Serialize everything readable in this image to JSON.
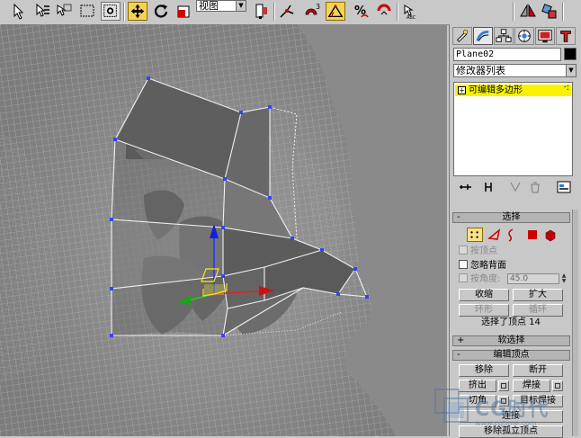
{
  "toolbar": {
    "view_selector": "视图",
    "snap_value": "3",
    "active_tool": "select-and-move"
  },
  "command_panel": {
    "object_name": "Plane02",
    "object_color": "#000000",
    "modifier_list": "修改器列表",
    "modifier_stack": [
      {
        "label": "可编辑多边形",
        "expand_glyph": "+",
        "highlight": "#f8f200"
      }
    ],
    "rollouts": {
      "selection": {
        "header": "选择",
        "sign": "-",
        "by_vertex": "按顶点",
        "ignore_backfacing": "忽略背面",
        "by_angle": "按角度:",
        "angle_value": "45.0",
        "shrink": "收缩",
        "grow": "扩大",
        "ring": "环形",
        "loop": "循环",
        "status": "选择了顶点 14"
      },
      "soft_selection": {
        "header": "软选择",
        "sign": "+"
      },
      "edit_vertices": {
        "header": "编辑顶点",
        "sign": "-",
        "remove": "移除",
        "break": "断开",
        "extrude": "挤出",
        "weld": "焊接",
        "chamfer": "切角",
        "target_weld": "目标焊接",
        "connect": "连接",
        "remove_isolated": "移除孤立顶点"
      }
    }
  },
  "watermark": {
    "brand": "CG时代",
    "url": "www.cgtime.com"
  },
  "colors": {
    "ui_gray": "#c8c8c8",
    "viewport_gray": "#8d8d8d",
    "active_tool": "#f4d25a",
    "stack_highlight": "#f8f200",
    "gizmo_y": "#0000ff",
    "gizmo_x": "#ff0000",
    "gizmo_z": "#00cc00"
  }
}
